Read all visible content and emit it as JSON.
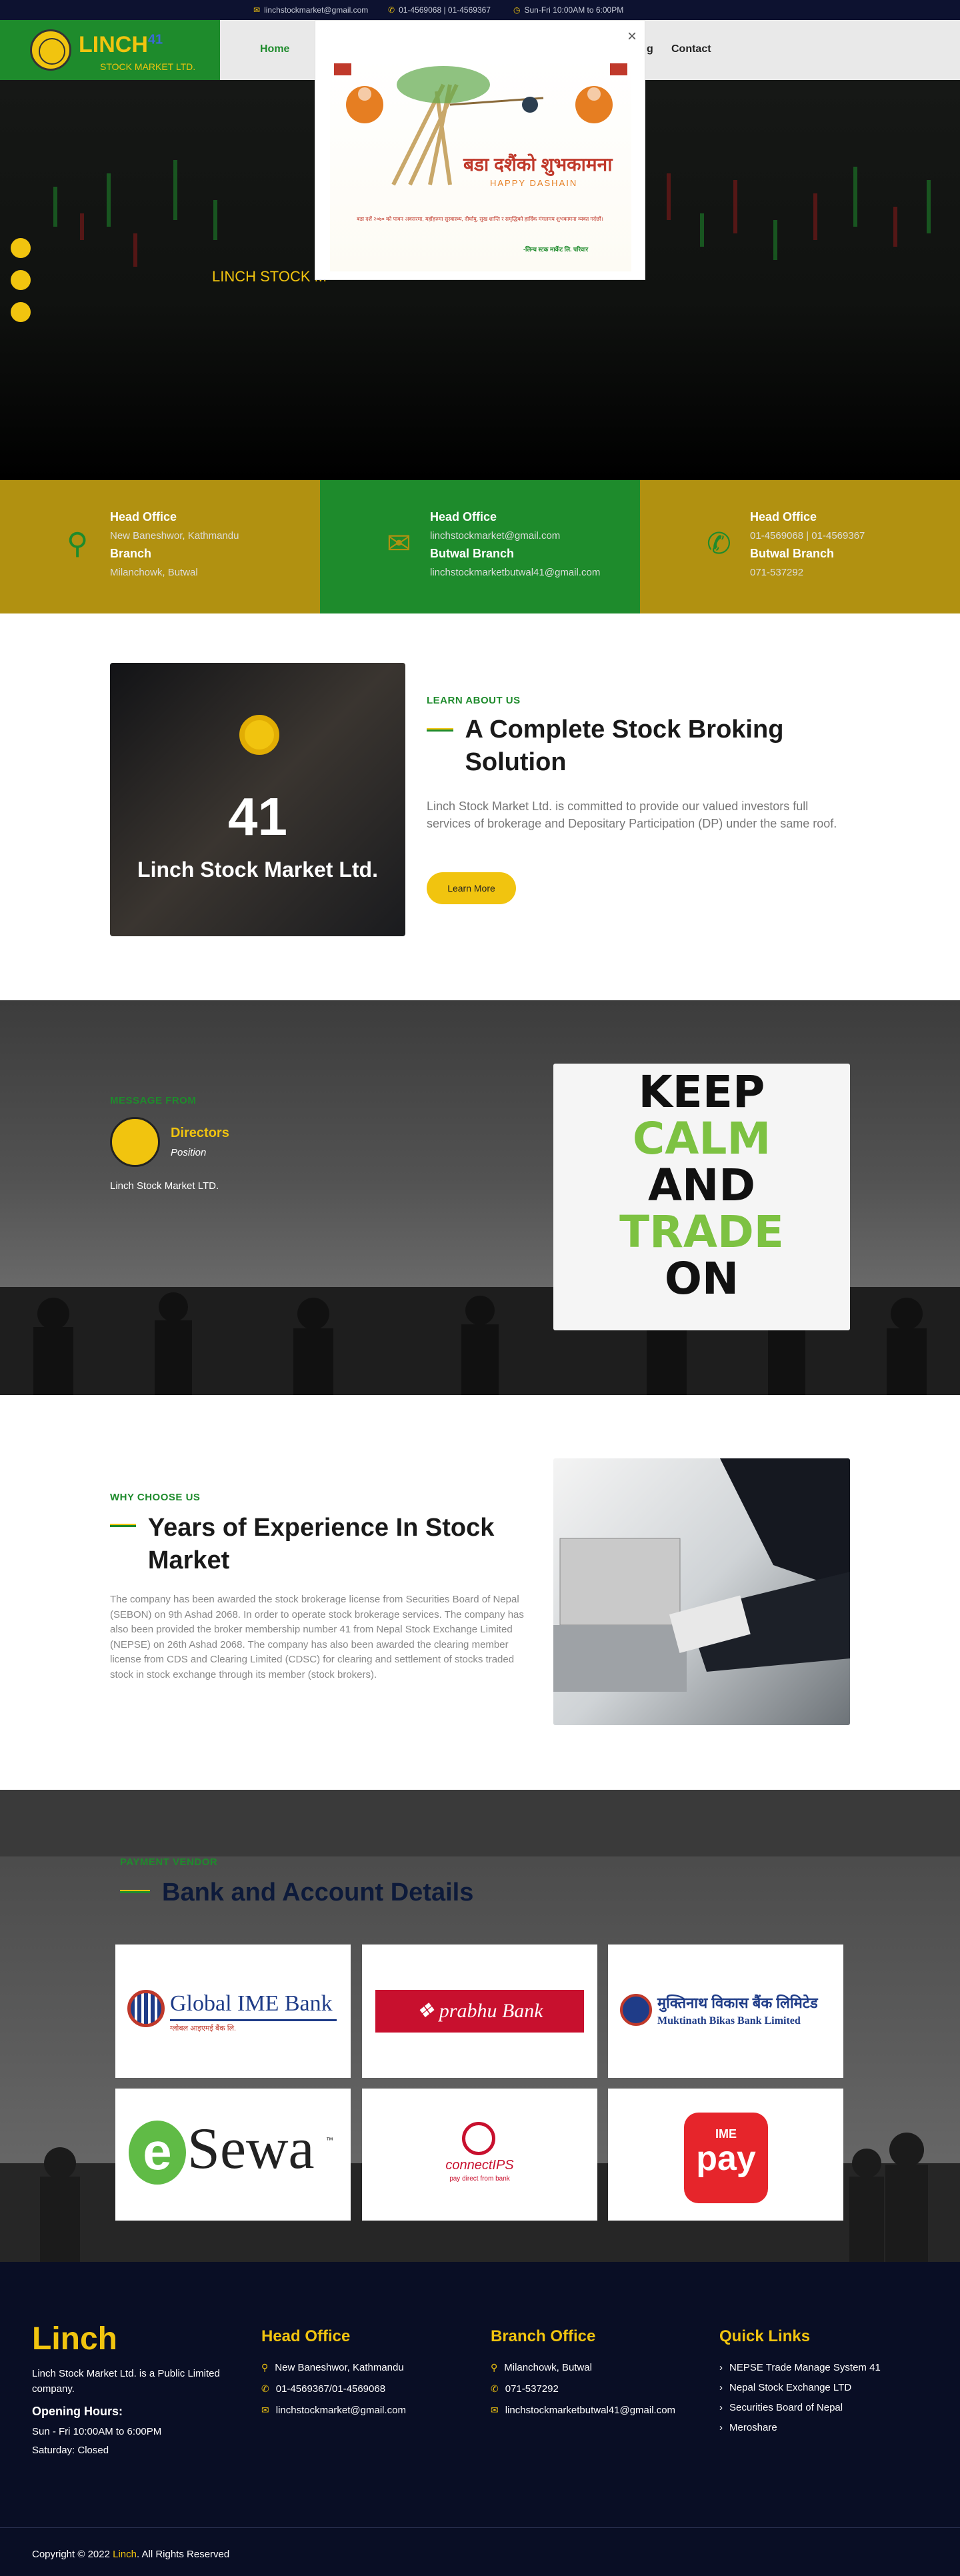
{
  "topbar": {
    "email": "linchstockmarket@gmail.com",
    "phone": "01-4569068 | 01-4569367",
    "hours": "Sun-Fri 10:00AM to 6:00PM"
  },
  "brand": {
    "name": "LINCH",
    "sup": "41",
    "tagline": "STOCK MARKET LTD."
  },
  "nav": {
    "home": "Home",
    "partial": "g",
    "contact": "Contact"
  },
  "hero": {
    "title": "LINCH STOCK M"
  },
  "popup": {
    "close": "×",
    "greeting_np": "बडा दशैंको शुभकामना",
    "greeting_en": "HAPPY DASHAIN",
    "message": "बडा दशैं २०७० को पावन अवसरमा, यहाँहरुमा सुस्वास्थ्य, दीर्घायु, सुख शान्ति र समृद्धिको हार्दिक मंगलमय शुभकामना व्यक्त गर्दछौं।",
    "signature": "-लिन्च स्टक मार्केट लि. परिवार"
  },
  "contact_band": [
    {
      "title": "Head Office",
      "line1": "New Baneshwor, Kathmandu",
      "title2": "Branch",
      "line2": "Milanchowk, Butwal",
      "icon": "map-marker-icon"
    },
    {
      "title": "Head Office",
      "line1": "linchstockmarket@gmail.com",
      "title2": "Butwal Branch",
      "line2": "linchstockmarketbutwal41@gmail.com",
      "icon": "envelope-open-icon"
    },
    {
      "title": "Head Office",
      "line1": "01-4569068 | 01-4569367",
      "title2": "Butwal Branch",
      "line2": "071-537292",
      "icon": "phone-icon"
    }
  ],
  "about": {
    "card_number": "41",
    "card_name": "Linch Stock Market Ltd.",
    "kicker": "LEARN ABOUT US",
    "heading": "A Complete Stock Broking Solution",
    "body": "Linch Stock Market Ltd. is committed to provide our valued investors full services of brokerage and Depositary Participation (DP) under the same roof.",
    "button": "Learn More"
  },
  "message": {
    "kicker": "MESSAGE FROM",
    "name": "Directors",
    "position": "Position",
    "company": "Linch Stock Market LTD.",
    "poster": [
      "KEEP",
      "CALM",
      "AND",
      "TRADE",
      "ON"
    ]
  },
  "why": {
    "kicker": "WHY CHOOSE US",
    "heading": "Years of Experience In Stock Market",
    "body": "The company has been awarded the stock brokerage license from Securities Board of Nepal (SEBON) on 9th Ashad 2068. In order to operate stock brokerage services. The company has also been provided the broker membership number 41 from Nepal Stock Exchange Limited (NEPSE) on 26th Ashad 2068. The company has also been awarded the clearing member license from CDS and Clearing Limited (CDSC) for clearing and settlement of stocks traded stock in stock exchange through its member (stock brokers)."
  },
  "banks": {
    "kicker": "PAYMENT VENDOR",
    "heading": "Bank and Account Details",
    "global_ime": "Global IME Bank",
    "global_ime_np": "ग्लोबल आइएमई बैंक लि.",
    "prabhu": "prabhu Bank",
    "muktinath_np": "मुक्तिनाथ विकास बैंक लिमिटेड",
    "muktinath": "Muktinath Bikas Bank Limited",
    "esewa": "Sewa",
    "esewa_e": "e",
    "esewa_tm": "™",
    "connectips": "connectIPS",
    "connectips_sub": "pay direct from bank",
    "imepay_top": "IME",
    "imepay": "pay"
  },
  "footer": {
    "brand": "Linch",
    "about": "Linch Stock Market Ltd. is a Public Limited company.",
    "hours_title": "Opening Hours:",
    "hours1": "Sun - Fri 10:00AM to 6:00PM",
    "hours2": "Saturday: Closed",
    "head_title": "Head Office",
    "head_addr": "New Baneshwor, Kathmandu",
    "head_phone": "01-4569367/01-4569068",
    "head_email": "linchstockmarket@gmail.com",
    "branch_title": "Branch Office",
    "branch_addr": "Milanchowk, Butwal",
    "branch_phone": "071-537292",
    "branch_email": "linchstockmarketbutwal41@gmail.com",
    "links_title": "Quick Links",
    "links": [
      "NEPSE Trade Manage System 41",
      "Nepal Stock Exchange LTD",
      "Securities Board of Nepal",
      "Meroshare"
    ],
    "copy_prefix": "Copyright © 2022 ",
    "copy_brand": "Linch",
    "copy_suffix": ". All Rights Reserved"
  },
  "colors": {
    "green": "#1e8b2c",
    "yellow": "#f1c40f",
    "navy": "#090e25"
  }
}
